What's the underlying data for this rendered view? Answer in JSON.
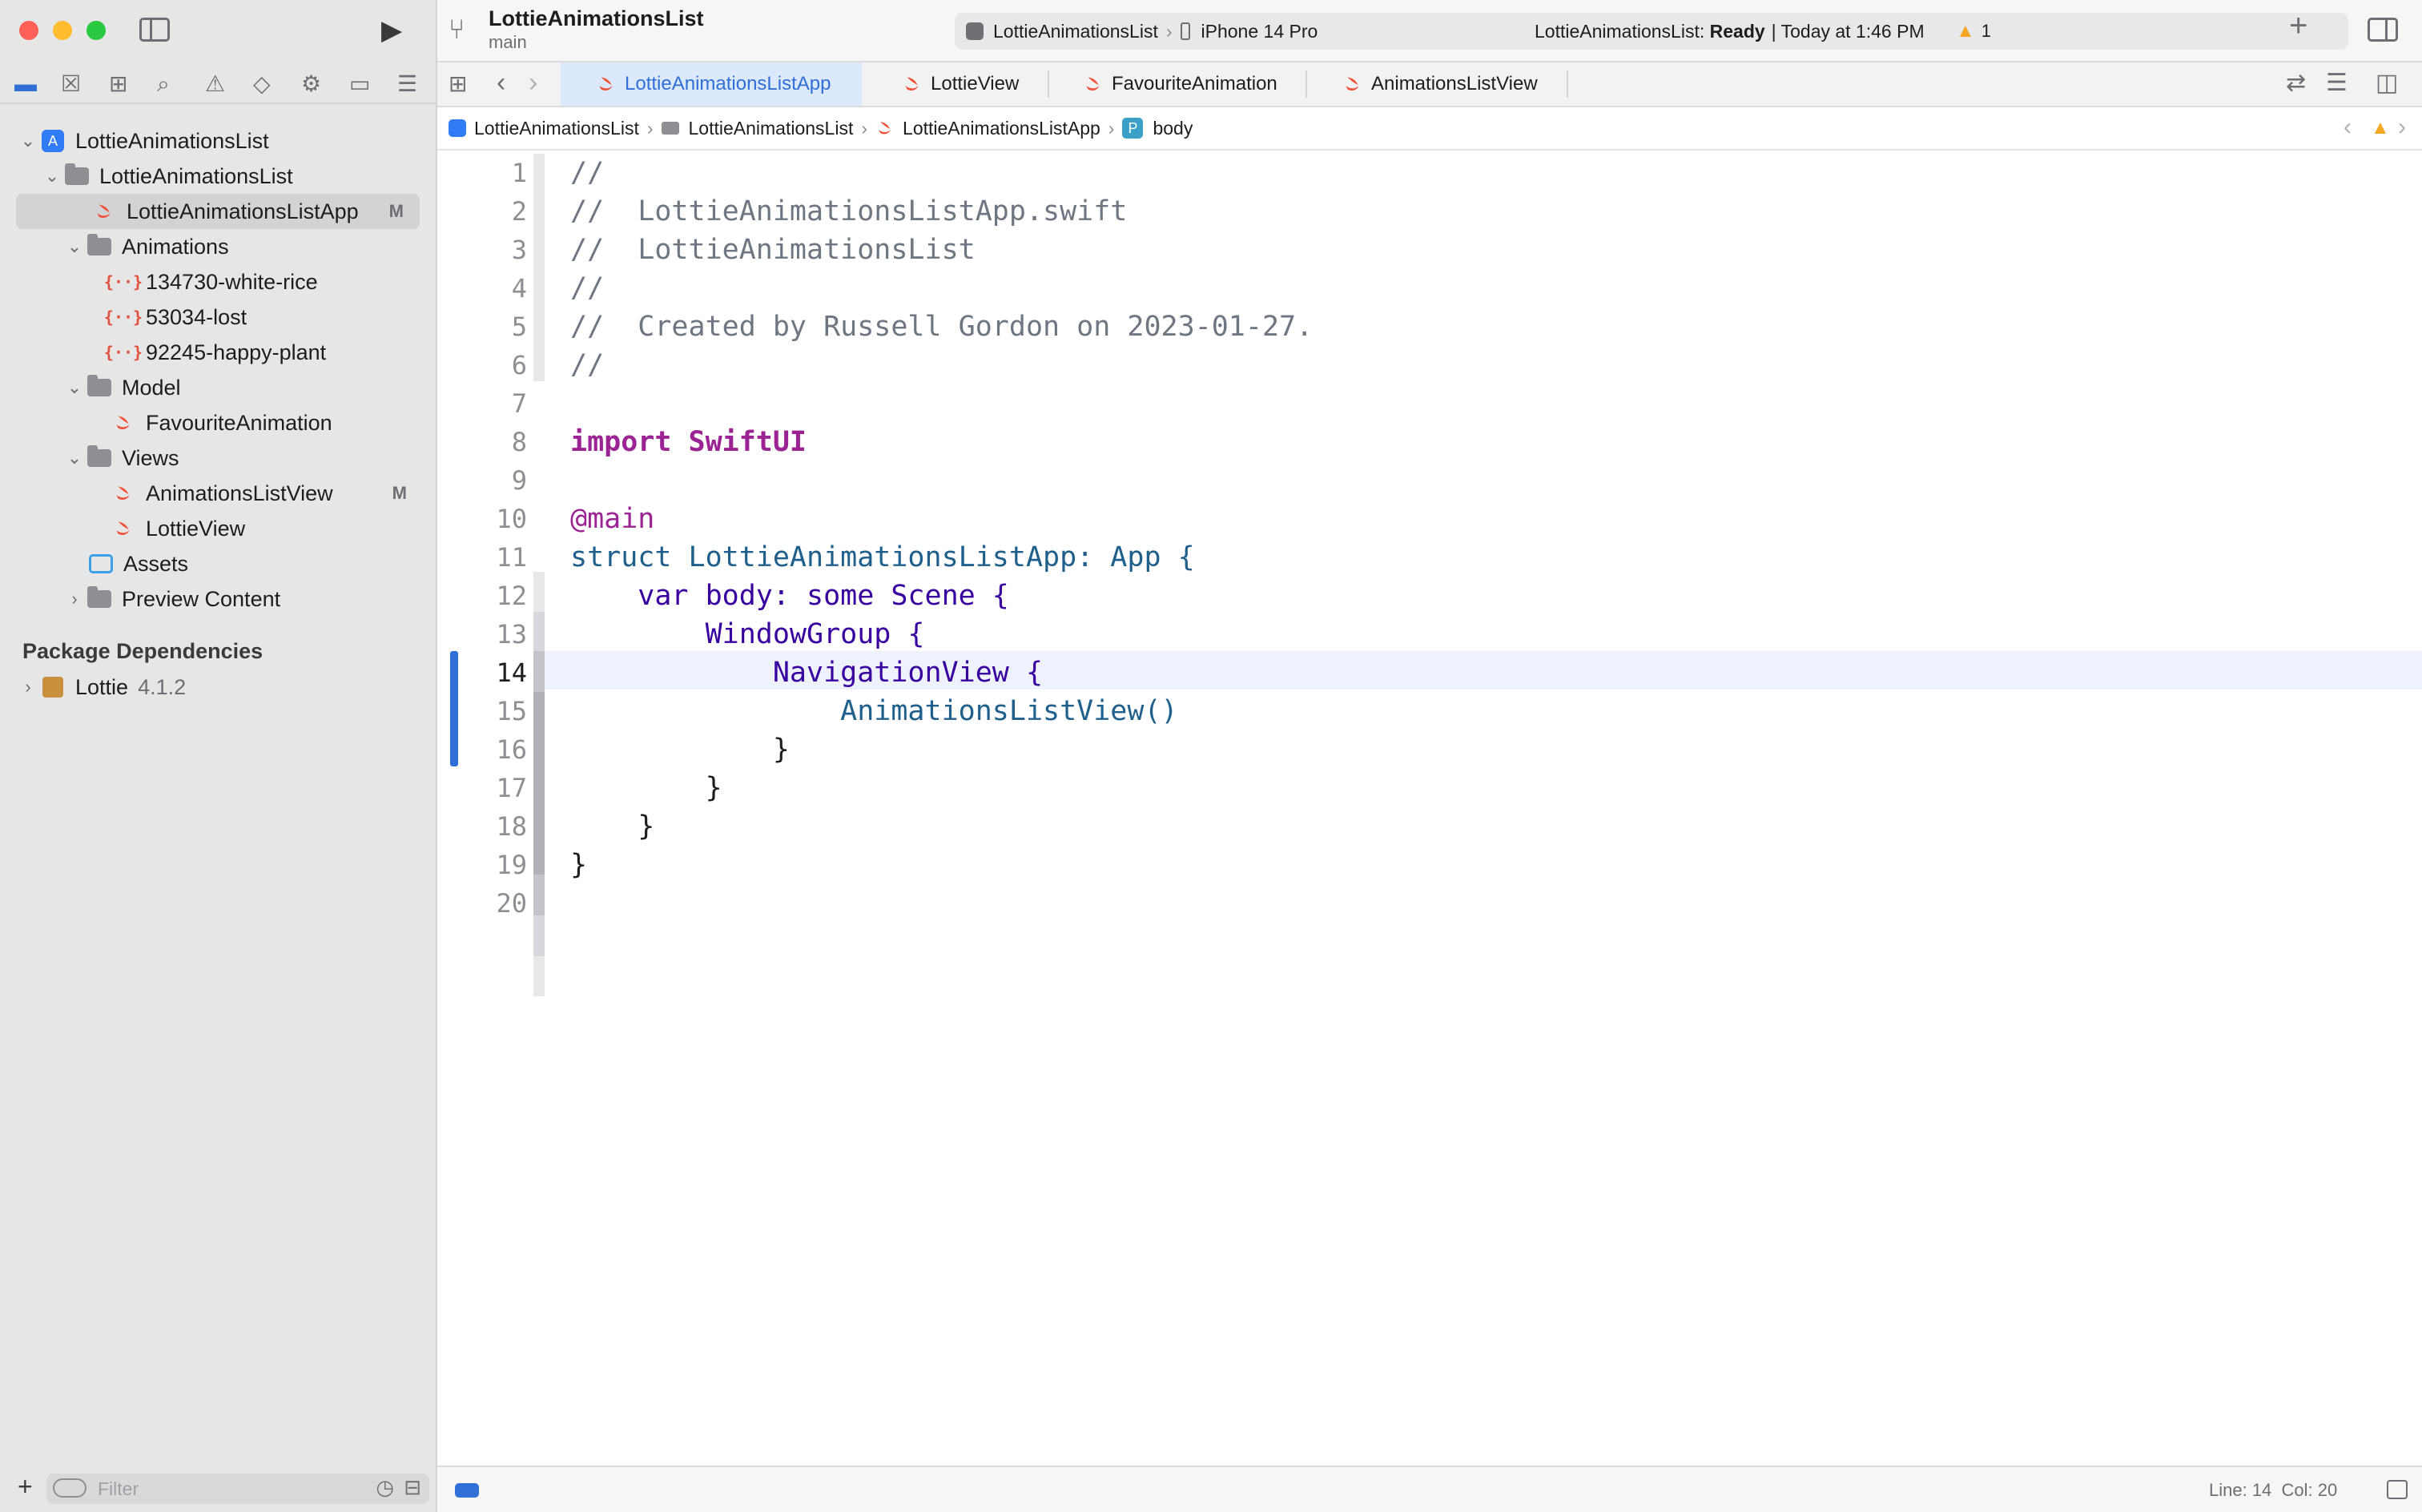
{
  "window": {
    "scheme_title": "LottieAnimationsList",
    "branch": "main"
  },
  "toolbar": {
    "scheme": "LottieAnimationsList",
    "device": "iPhone 14 Pro",
    "status_prefix": "LottieAnimationsList: ",
    "status_state": "Ready",
    "status_time": "| Today at 1:46 PM",
    "warning_count": "1"
  },
  "tabs": [
    {
      "label": "LottieAnimationsListApp",
      "active": true
    },
    {
      "label": "LottieView"
    },
    {
      "label": "FavouriteAnimation"
    },
    {
      "label": "AnimationsListView"
    }
  ],
  "jumpbar": {
    "items": [
      "LottieAnimationsList",
      "LottieAnimationsList",
      "LottieAnimationsListApp",
      "body"
    ],
    "symbol_badge": "P"
  },
  "navigator": {
    "tree": [
      {
        "label": "LottieAnimationsList"
      },
      {
        "label": "LottieAnimationsList"
      },
      {
        "label": "LottieAnimationsListApp",
        "badge": "M"
      },
      {
        "label": "Animations"
      },
      {
        "label": "134730-white-rice",
        "icon_text": "{··}"
      },
      {
        "label": "53034-lost",
        "icon_text": "{··}"
      },
      {
        "label": "92245-happy-plant",
        "icon_text": "{··}"
      },
      {
        "label": "Model"
      },
      {
        "label": "FavouriteAnimation"
      },
      {
        "label": "Views"
      },
      {
        "label": "AnimationsListView",
        "badge": "M"
      },
      {
        "label": "LottieView"
      },
      {
        "label": "Assets"
      },
      {
        "label": "Preview Content"
      }
    ],
    "package_header": "Package Dependencies",
    "package": {
      "name": "Lottie",
      "version": "4.1.2"
    },
    "filter_placeholder": "Filter"
  },
  "editor": {
    "current_line": 14,
    "lines": [
      {
        "n": "1",
        "code": "//"
      },
      {
        "n": "2",
        "code": "//  LottieAnimationsListApp.swift"
      },
      {
        "n": "3",
        "code": "//  LottieAnimationsList"
      },
      {
        "n": "4",
        "code": "//"
      },
      {
        "n": "5",
        "code": "//  Created by Russell Gordon on 2023-01-27."
      },
      {
        "n": "6",
        "code": "//"
      },
      {
        "n": "7",
        "code": ""
      },
      {
        "n": "8",
        "code": "import SwiftUI"
      },
      {
        "n": "9",
        "code": ""
      },
      {
        "n": "10",
        "code": "@main"
      },
      {
        "n": "11",
        "code": "struct LottieAnimationsListApp: App {"
      },
      {
        "n": "12",
        "code": "    var body: some Scene {"
      },
      {
        "n": "13",
        "code": "        WindowGroup {"
      },
      {
        "n": "14",
        "code": "            NavigationView {"
      },
      {
        "n": "15",
        "code": "                AnimationsListView()"
      },
      {
        "n": "16",
        "code": "            }"
      },
      {
        "n": "17",
        "code": "        }"
      },
      {
        "n": "18",
        "code": "    }"
      },
      {
        "n": "19",
        "code": "}"
      },
      {
        "n": "20",
        "code": ""
      }
    ]
  },
  "statusbar": {
    "position": "Line: 14  Col: 20"
  }
}
